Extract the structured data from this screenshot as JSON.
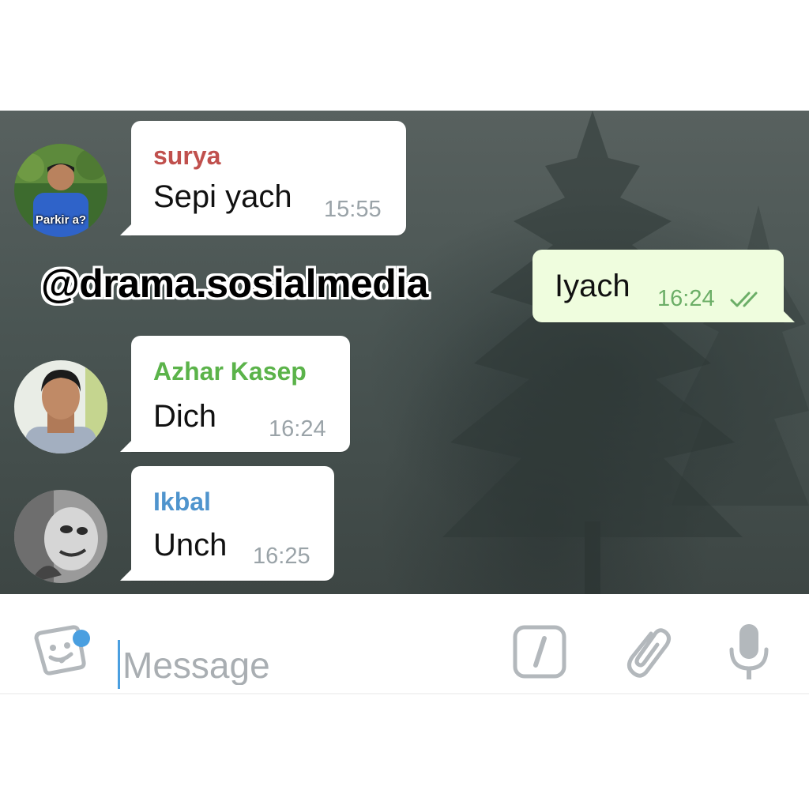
{
  "watermark": "@drama.sosialmedia",
  "messages": [
    {
      "sender": "surya",
      "sender_color": "#c0504d",
      "text": "Sepi yach",
      "time": "15:55",
      "avatar_label": "Parkir a?"
    },
    {
      "text": "Iyach",
      "time": "16:24",
      "status_icon": "double-check-icon",
      "outgoing": true
    },
    {
      "sender": "Azhar Kasep",
      "sender_color": "#5bb34a",
      "text": "Dich",
      "time": "16:24"
    },
    {
      "sender": "Ikbal",
      "sender_color": "#4f94cd",
      "text": "Unch",
      "time": "16:25"
    }
  ],
  "composer": {
    "placeholder": "Message",
    "icons": [
      "sticker-icon",
      "bot-command-icon",
      "attach-paperclip-icon",
      "microphone-icon"
    ],
    "accent_color": "#4a9fe0"
  }
}
